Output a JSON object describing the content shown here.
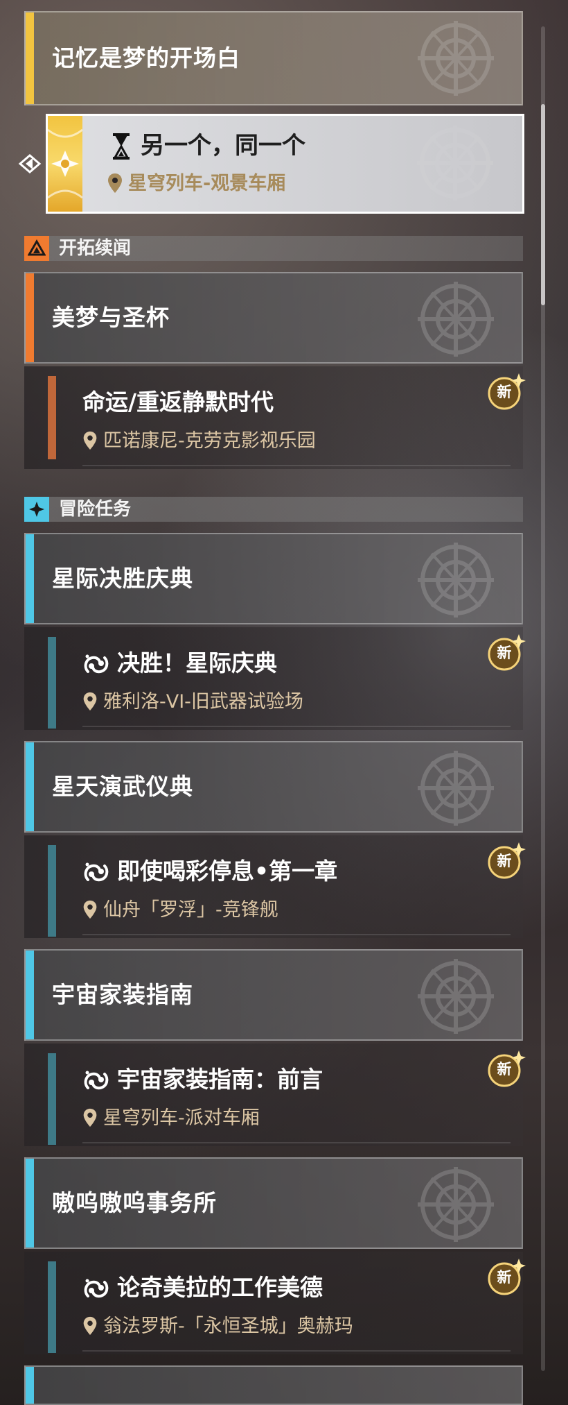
{
  "top_group": {
    "title": "记忆是梦的开场白"
  },
  "selected_quest": {
    "title": "另一个，同一个",
    "location": "星穹列车-观景车厢",
    "icon": "hourglass-icon"
  },
  "sections": [
    {
      "title": "开拓续闻",
      "icon": "trailblaze-icon",
      "accent": "#f07b30",
      "groups": [
        {
          "title": "美梦与圣杯",
          "quests": [
            {
              "title": "命运/重返静默时代",
              "location": "匹诺康尼-克劳克影视乐园",
              "badge": "新"
            }
          ]
        }
      ]
    },
    {
      "title": "冒险任务",
      "icon": "adventure-star-icon",
      "accent": "#4fc7e6",
      "groups": [
        {
          "title": "星际决胜庆典",
          "quests": [
            {
              "title": "决胜！星际庆典",
              "location": "雅利洛-VI-旧武器试验场",
              "badge": "新"
            }
          ]
        },
        {
          "title": "星天演武仪典",
          "quests": [
            {
              "title": "即使喝彩停息•第一章",
              "location": "仙舟「罗浮」-竞锋舰",
              "badge": "新"
            }
          ]
        },
        {
          "title": "宇宙家装指南",
          "quests": [
            {
              "title": "宇宙家装指南：前言",
              "location": "星穹列车-派对车厢",
              "badge": "新"
            }
          ]
        },
        {
          "title": "嗷呜嗷呜事务所",
          "quests": [
            {
              "title": "论奇美拉的工作美德",
              "location": "翁法罗斯-「永恒圣城」奥赫玛",
              "badge": "新"
            }
          ]
        }
      ]
    }
  ],
  "colors": {
    "gold": "#f2c440",
    "story_orange": "#f07b30",
    "adventure_cyan": "#4fc7e6",
    "location_tan": "#dcc6a4"
  }
}
